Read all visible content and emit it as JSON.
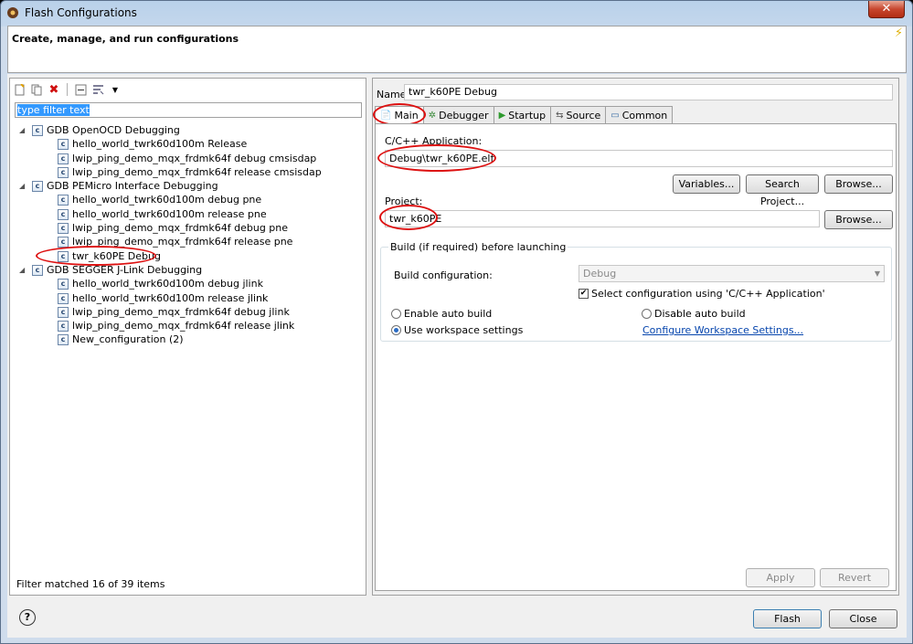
{
  "window": {
    "title": "Flash Configurations",
    "close_label": "✕"
  },
  "header": {
    "title": "Create, manage, and run configurations"
  },
  "left": {
    "filter_placeholder": "type filter text",
    "tree": [
      {
        "level": 0,
        "label": "GDB OpenOCD Debugging"
      },
      {
        "level": 1,
        "label": "hello_world_twrk60d100m Release"
      },
      {
        "level": 1,
        "label": "lwip_ping_demo_mqx_frdmk64f debug cmsisdap"
      },
      {
        "level": 1,
        "label": "lwip_ping_demo_mqx_frdmk64f release cmsisdap"
      },
      {
        "level": 0,
        "label": "GDB PEMicro Interface Debugging"
      },
      {
        "level": 1,
        "label": "hello_world_twrk60d100m debug pne"
      },
      {
        "level": 1,
        "label": "hello_world_twrk60d100m release pne"
      },
      {
        "level": 1,
        "label": "lwip_ping_demo_mqx_frdmk64f debug pne"
      },
      {
        "level": 1,
        "label": "lwip_ping_demo_mqx_frdmk64f release pne"
      },
      {
        "level": 1,
        "label": "twr_k60PE Debug"
      },
      {
        "level": 0,
        "label": "GDB SEGGER J-Link Debugging"
      },
      {
        "level": 1,
        "label": "hello_world_twrk60d100m debug jlink"
      },
      {
        "level": 1,
        "label": "hello_world_twrk60d100m release jlink"
      },
      {
        "level": 1,
        "label": "lwip_ping_demo_mqx_frdmk64f debug jlink"
      },
      {
        "level": 1,
        "label": "lwip_ping_demo_mqx_frdmk64f release jlink"
      },
      {
        "level": 1,
        "label": "New_configuration (2)"
      }
    ],
    "filter_status": "Filter matched 16 of 39 items"
  },
  "right": {
    "name_label": "Name:",
    "name_value": "twr_k60PE Debug",
    "tabs": [
      {
        "label": "Main",
        "icon": "page-icon"
      },
      {
        "label": "Debugger",
        "icon": "bug-icon"
      },
      {
        "label": "Startup",
        "icon": "play-icon"
      },
      {
        "label": "Source",
        "icon": "source-icon"
      },
      {
        "label": "Common",
        "icon": "window-icon"
      }
    ],
    "app_label": "C/C++ Application:",
    "app_value": "Debug\\twr_k60PE.elf",
    "variables_label": "Variables...",
    "search_project_label": "Search Project...",
    "browse_label": "Browse...",
    "project_label": "Project:",
    "project_value": "twr_k60PE",
    "browse2_label": "Browse...",
    "build_group_title": "Build (if required) before launching",
    "build_config_label": "Build configuration:",
    "build_config_value": "Debug",
    "select_config_label": "Select configuration using 'C/C++ Application'",
    "enable_auto_label": "Enable auto build",
    "disable_auto_label": "Disable auto build",
    "workspace_label": "Use workspace settings",
    "configure_link": "Configure Workspace Settings...",
    "apply_label": "Apply",
    "revert_label": "Revert"
  },
  "footer": {
    "help_label": "?",
    "flash_label": "Flash",
    "close_label": "Close"
  }
}
